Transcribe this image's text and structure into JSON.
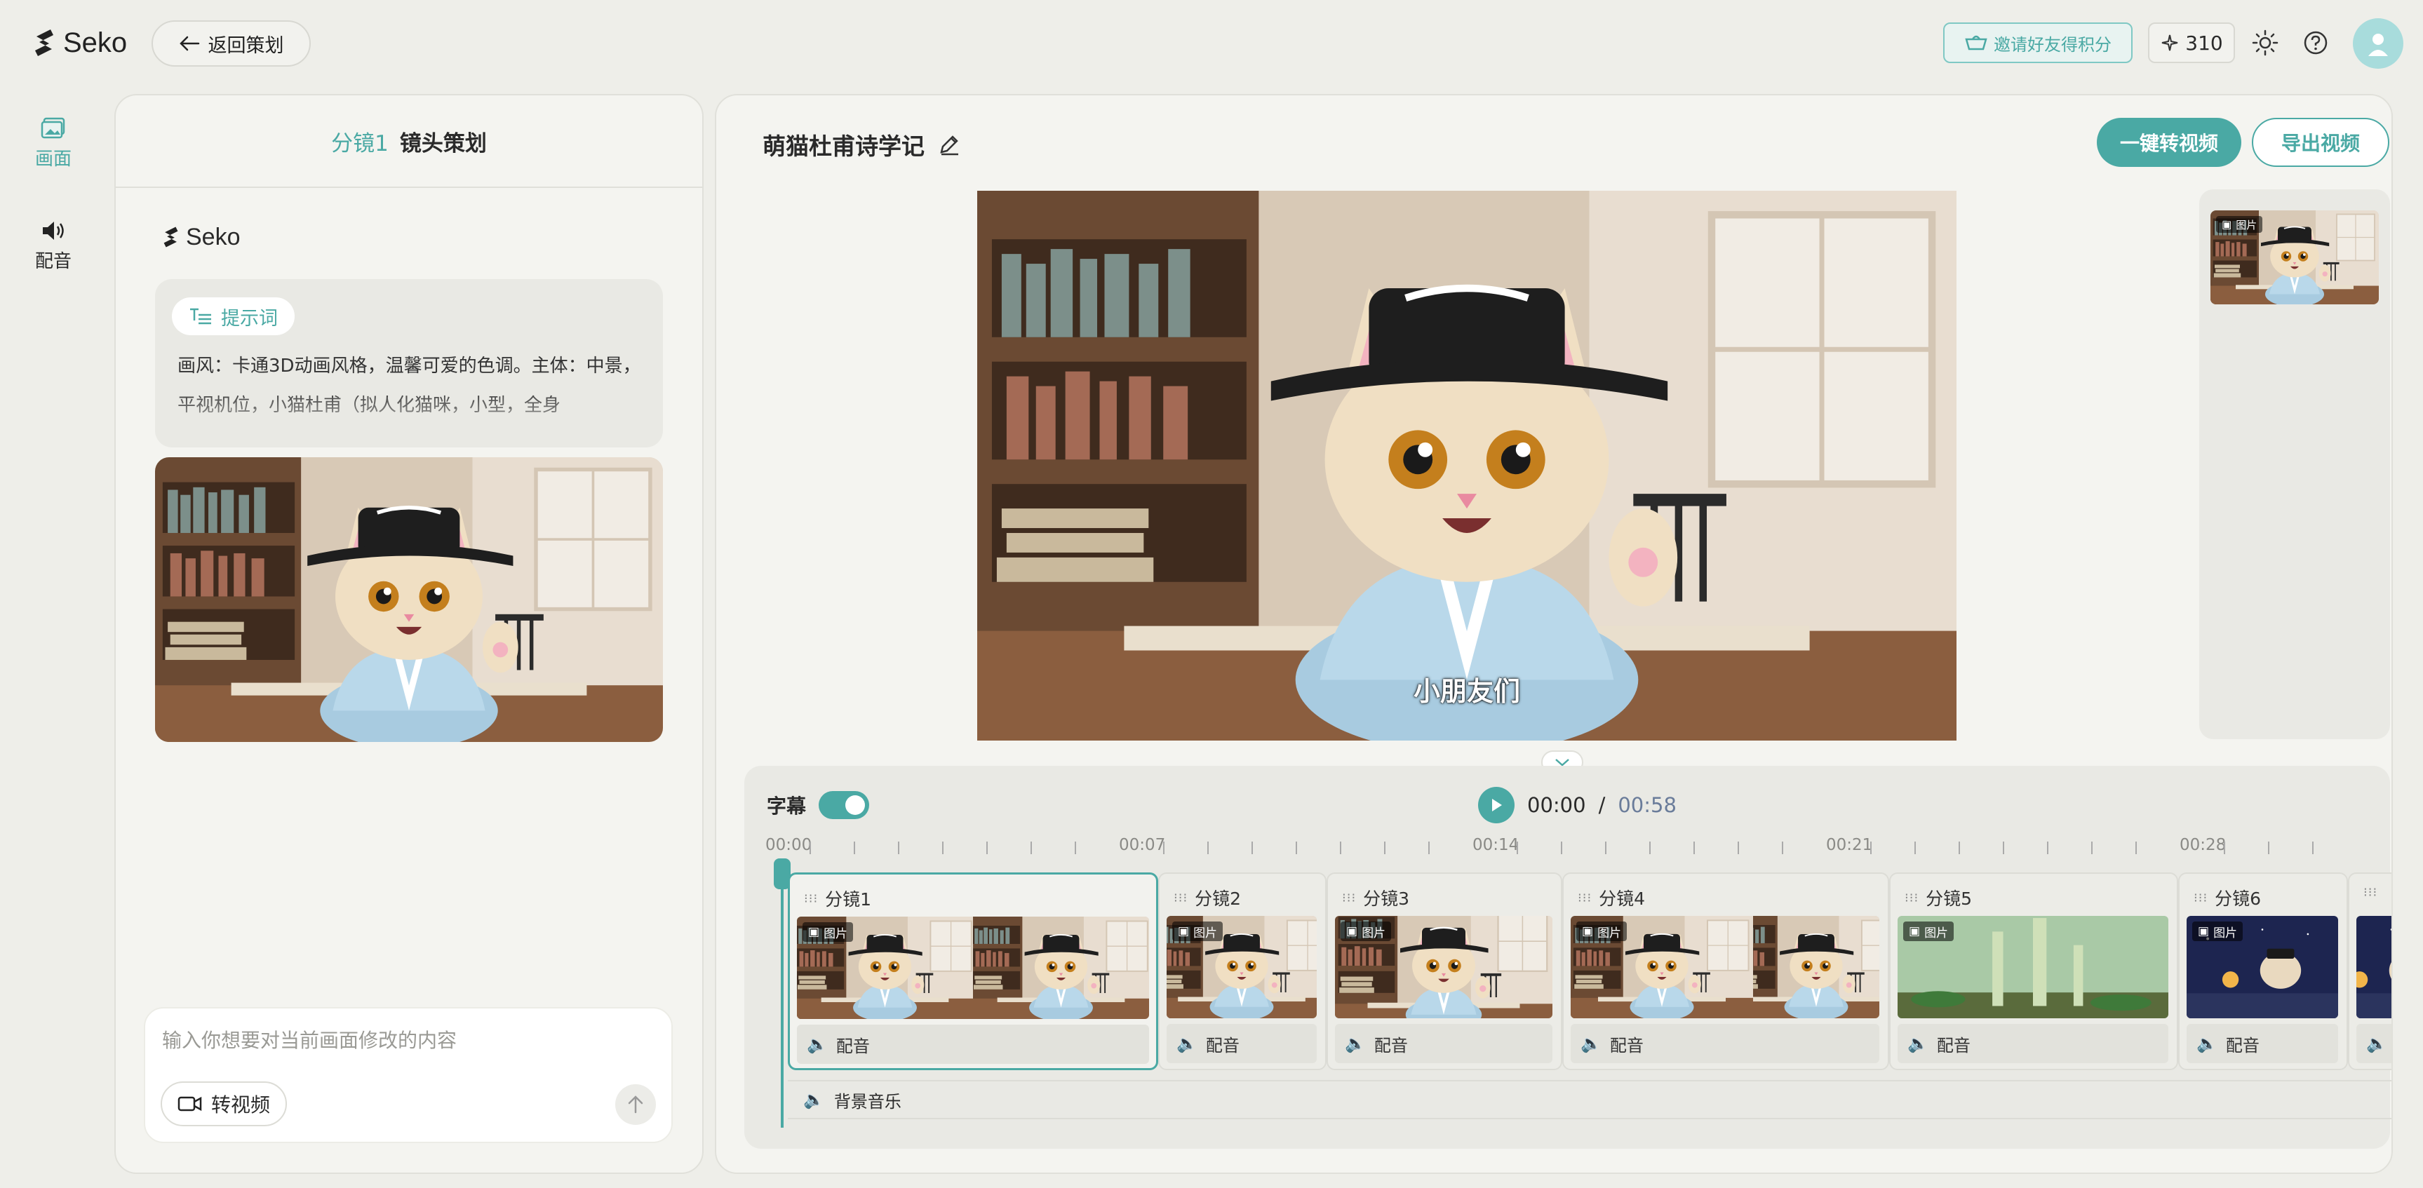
{
  "app": {
    "logo_text": "Seko",
    "back_label": "返回策划"
  },
  "topbar": {
    "invite_label": "邀请好友得积分",
    "credits": "310"
  },
  "rail": {
    "picture_label": "画面",
    "dub_label": "配音"
  },
  "left_panel": {
    "title_highlight": "分镜1",
    "title_rest": "镜头策划",
    "brand": "Seko",
    "prompt_tag": "提示词",
    "prompt_text": "画风：卡通3D动画风格，温馨可爱的色调。主体：中景，平视机位，小猫杜甫（拟人化猫咪，小型，全身",
    "input_placeholder": "输入你想要对当前画面修改的内容",
    "to_video_label": "转视频"
  },
  "main": {
    "project_title": "萌猫杜甫诗学记",
    "primary_btn": "一键转视频",
    "export_btn": "导出视频",
    "subtitle_text": "小朋友们",
    "side_thumb_tag": "图片"
  },
  "timeline": {
    "cc_label": "字幕",
    "current_time": "00:00",
    "separator": "/",
    "total_time": "00:58",
    "ruler_labels": [
      "00:00",
      "00:07",
      "00:14",
      "00:21",
      "00:28"
    ],
    "clips": [
      {
        "name": "分镜1",
        "tag": "图片",
        "dub": "配音"
      },
      {
        "name": "分镜2",
        "tag": "图片",
        "dub": "配音"
      },
      {
        "name": "分镜3",
        "tag": "图片",
        "dub": "配音"
      },
      {
        "name": "分镜4",
        "tag": "图片",
        "dub": "配音"
      },
      {
        "name": "分镜5",
        "tag": "图片",
        "dub": "配音"
      },
      {
        "name": "分镜6",
        "tag": "图片",
        "dub": "配音"
      }
    ],
    "bgm_label": "背景音乐"
  },
  "colors": {
    "accent": "#4aa9a4",
    "background": "#eeeee9",
    "panel": "#f4f4f0"
  }
}
